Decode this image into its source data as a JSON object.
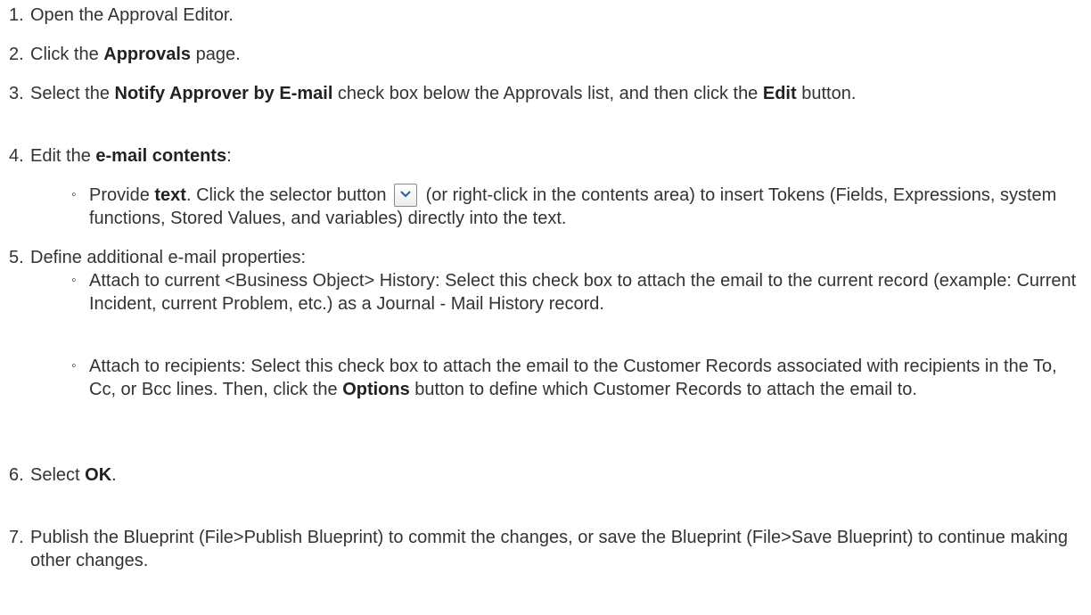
{
  "steps": [
    {
      "number": "1.",
      "parts": [
        "Open the Approval Editor."
      ]
    },
    {
      "number": "2.",
      "parts": [
        "Click the ",
        "Approvals",
        " page."
      ]
    },
    {
      "number": "3.",
      "parts": [
        "Select the ",
        "Notify Approver by E-mail",
        " check box below the Approvals list, and then click the ",
        "Edit",
        " button."
      ]
    },
    {
      "number": "4.",
      "parts": [
        "Edit the ",
        "e-mail contents",
        ":"
      ],
      "subitems": [
        {
          "bullet": "◦",
          "parts": [
            "Provide ",
            "text",
            ". Click the selector button ",
            " (or right-click in the contents area) to insert Tokens (Fields, Expressions, system functions, Stored Values, and variables) directly into the text."
          ]
        }
      ]
    },
    {
      "number": "5.",
      "parts": [
        "Define additional e-mail properties:"
      ],
      "subitems": [
        {
          "bullet": "◦",
          "parts": [
            "Attach to current <Business Object> History: Select this check box to attach the email to the current record (example: Current Incident, current Problem, etc.) as a Journal - Mail History record."
          ]
        },
        {
          "bullet": "◦",
          "parts": [
            "Attach to recipients: Select this check box to attach the email to the Customer Records associated with recipients in the To, Cc, or Bcc lines. Then, click the ",
            "Options",
            " button to define which Customer Records to attach the email to."
          ]
        }
      ]
    },
    {
      "number": "6.",
      "parts": [
        "Select ",
        "OK",
        "."
      ]
    },
    {
      "number": "7.",
      "parts": [
        "Publish the Blueprint (File>Publish Blueprint) to commit the changes, or save the Blueprint (File>Save Blueprint) to continue making other changes."
      ]
    }
  ]
}
